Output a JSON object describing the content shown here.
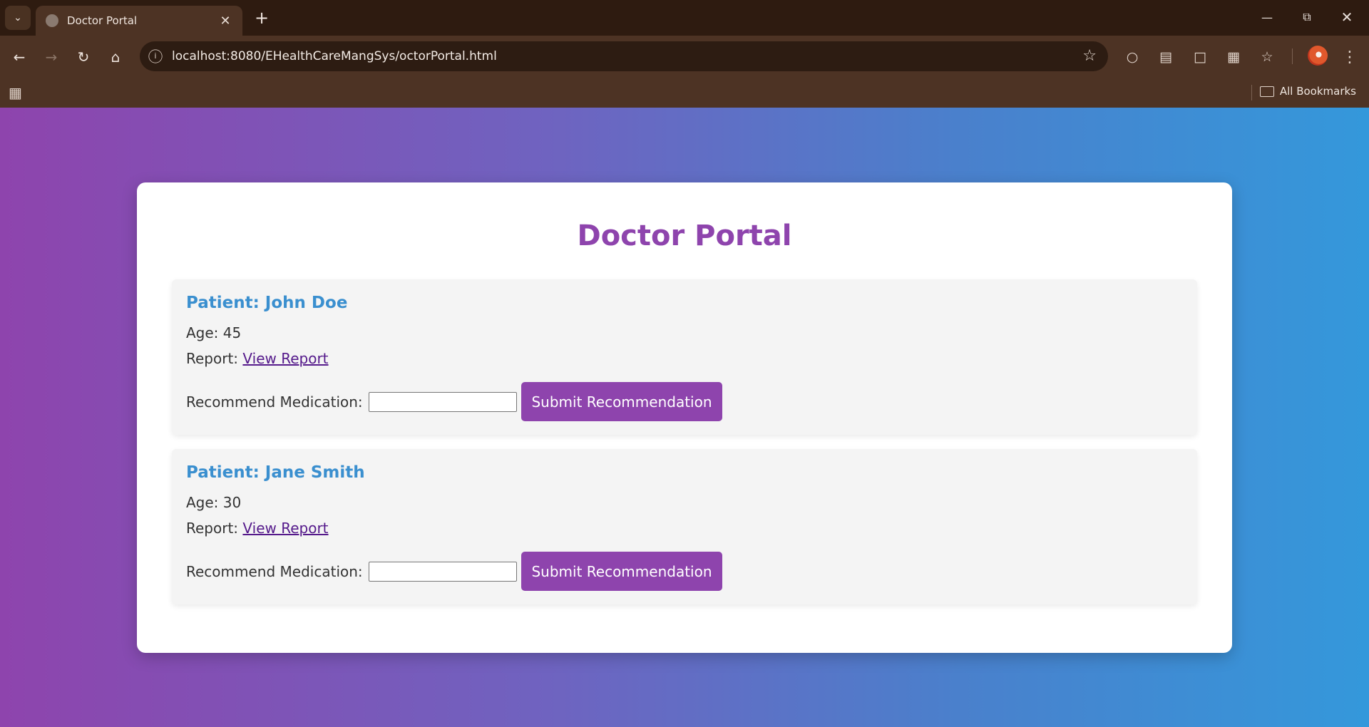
{
  "browser": {
    "tab_title": "Doctor Portal",
    "new_tab_label": "+",
    "url": "localhost:8080/EHealthCareMangSys/octorPortal.html",
    "all_bookmarks_label": "All Bookmarks"
  },
  "page": {
    "title": "Doctor Portal",
    "patients": [
      {
        "name_line": "Patient: John Doe",
        "age_label": "Age: 45",
        "report_prefix": "Report:",
        "report_link": "View Report",
        "recommend_label": "Recommend Medication:",
        "medication_value": "",
        "submit_label": "Submit Recommendation"
      },
      {
        "name_line": "Patient: Jane Smith",
        "age_label": "Age: 30",
        "report_prefix": "Report:",
        "report_link": "View Report",
        "recommend_label": "Recommend Medication:",
        "medication_value": "",
        "submit_label": "Submit Recommendation"
      }
    ]
  },
  "colors": {
    "accent_purple": "#8e44ad",
    "accent_blue": "#3498db",
    "chrome_brown": "#4d3324"
  }
}
